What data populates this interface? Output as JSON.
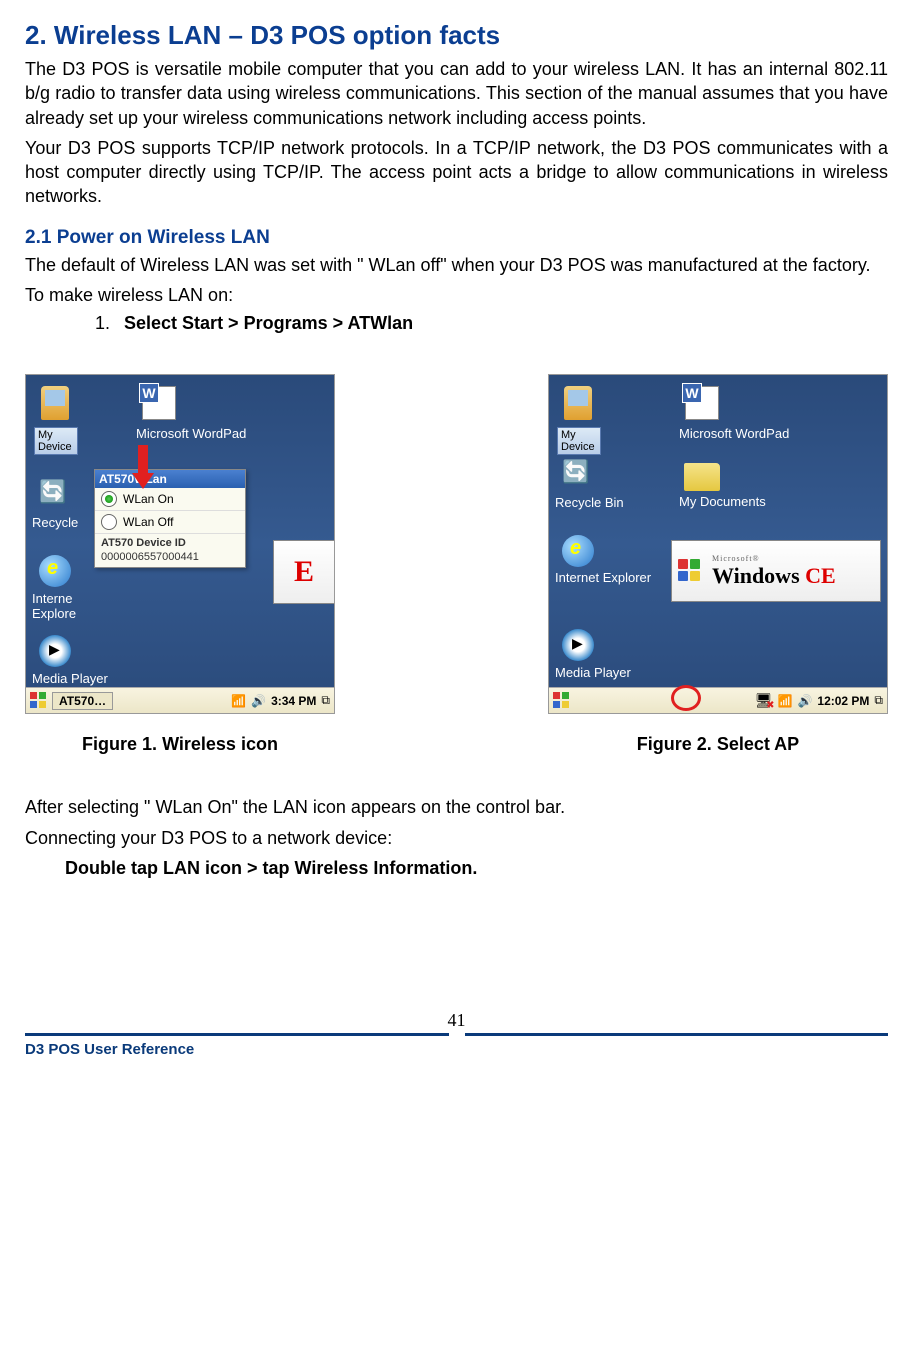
{
  "heading1": "2. Wireless LAN – D3 POS option facts",
  "para1": "The D3 POS is versatile mobile computer that you can add to your wireless LAN. It has an internal 802.11 b/g radio to transfer data using wireless communications. This section of the manual assumes that you have already set up your wireless communications network including access points.",
  "para2": "Your D3 POS supports TCP/IP network protocols. In a TCP/IP network, the D3 POS communicates with a host computer directly using TCP/IP. The access point acts a bridge to allow communications in wireless networks.",
  "heading2": "2.1 Power on Wireless LAN",
  "para3": "The default of Wireless LAN was set with \" WLan off\"  when your D3 POS was manufactured at the factory.",
  "para4": "To make wireless LAN on:",
  "ol1_num": "1.",
  "ol1_text": "Select Start > Programs > ATWlan",
  "fig1": {
    "icons": {
      "myDevice": "My Device",
      "wordpad": "Microsoft WordPad",
      "recycle": "Recycle"
    },
    "popup": {
      "title": "AT570WLan",
      "opt_on": "WLan On",
      "opt_off": "WLan Off",
      "id_label": "AT570 Device ID",
      "id_value": "0000006557000441"
    },
    "ie_1": "Interne",
    "ie_2": "Explore",
    "media": "Media Player",
    "ce_cut": "E",
    "tb_task": "AT570…",
    "tb_time": "3:34 PM",
    "caption": "Figure 1. Wireless icon"
  },
  "fig2": {
    "icons": {
      "myDevice": "My Device",
      "wordpad": "Microsoft WordPad",
      "recycle": "Recycle Bin",
      "mydocs": "My Documents",
      "ie": "Internet Explorer",
      "media": "Media Player"
    },
    "winbadge_msft": "Microsoft®",
    "winbadge_core": "Windows",
    "winbadge_ce": " CE",
    "tb_time": "12:02 PM",
    "caption": "Figure 2. Select AP"
  },
  "after1": "After selecting \" WLan On\"  the LAN icon appears on the control bar.",
  "after2": "Connecting your D3 POS to a network device:",
  "after3": "Double tap LAN icon > tap Wireless Information.",
  "page_num": "41",
  "footer_ref": "D3 POS User Reference"
}
